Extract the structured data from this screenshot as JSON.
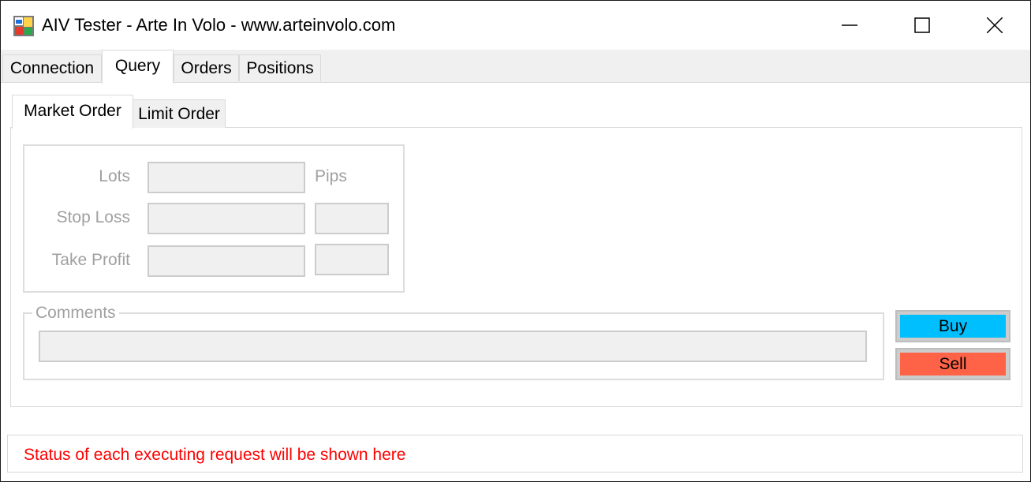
{
  "window": {
    "title": "AIV Tester - Arte In Volo - www.arteinvolo.com"
  },
  "main_tabs": [
    {
      "label": "Connection",
      "active": false
    },
    {
      "label": "Query",
      "active": true
    },
    {
      "label": "Orders",
      "active": false
    },
    {
      "label": "Positions",
      "active": false
    }
  ],
  "order_tabs": [
    {
      "label": "Market Order",
      "active": true
    },
    {
      "label": "Limit Order",
      "active": false
    }
  ],
  "order_form": {
    "lots_label": "Lots",
    "pips_label": "Pips",
    "stop_loss_label": "Stop Loss",
    "take_profit_label": "Take Profit",
    "lots_value": "",
    "stop_loss_value": "",
    "stop_loss_pips_value": "",
    "take_profit_value": "",
    "take_profit_pips_value": "",
    "comments_label": "Comments",
    "comments_value": "",
    "buy_label": "Buy",
    "sell_label": "Sell"
  },
  "status": {
    "text": "Status of each executing request will be shown here"
  },
  "colors": {
    "buy": "#00bfff",
    "sell": "#ff6347",
    "status_text": "#ff0000",
    "disabled_text": "#a0a0a0"
  },
  "icons": [
    "app-icon",
    "minimize-icon",
    "maximize-icon",
    "close-icon"
  ]
}
